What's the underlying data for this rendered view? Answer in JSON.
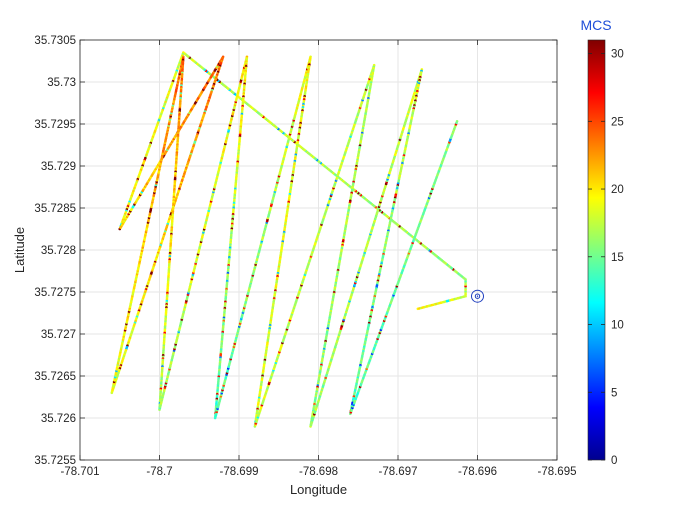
{
  "chart_data": {
    "type": "scatter",
    "title": "",
    "xlabel": "Longitude",
    "ylabel": "Latitude",
    "xlim": [
      -78.701,
      -78.695
    ],
    "ylim": [
      35.7255,
      35.7305
    ],
    "grid": true,
    "x_ticks": [
      -78.701,
      -78.7,
      -78.699,
      -78.698,
      -78.697,
      -78.696,
      -78.695
    ],
    "x_tick_labels": [
      "-78.701",
      "-78.7",
      "-78.699",
      "-78.698",
      "-78.697",
      "-78.696",
      "-78.695"
    ],
    "y_ticks": [
      35.7255,
      35.726,
      35.7265,
      35.727,
      35.7275,
      35.728,
      35.7285,
      35.729,
      35.7295,
      35.73,
      35.7305
    ],
    "y_tick_labels": [
      "35.7255",
      "35.726",
      "35.7265",
      "35.727",
      "35.7275",
      "35.728",
      "35.7285",
      "35.729",
      "35.7295",
      "35.73",
      "35.7305"
    ],
    "colorbar": {
      "title": "MCS",
      "title_color": "#1f4fd8",
      "colormap": "jet",
      "limits": [
        0,
        31
      ],
      "ticks": [
        0,
        5,
        10,
        15,
        20,
        25,
        30
      ],
      "tick_labels": [
        "0",
        "5",
        "10",
        "15",
        "20",
        "25",
        "30"
      ]
    },
    "marker": {
      "type": "circle-target",
      "x": -78.696,
      "y": 35.72745,
      "color": "#1f3fbf"
    },
    "path_vertices": [
      {
        "lon": -78.69675,
        "lat": 35.7273,
        "mcs": 19
      },
      {
        "lon": -78.69615,
        "lat": 35.72745,
        "mcs": 18
      },
      {
        "lon": -78.69615,
        "lat": 35.72765,
        "mcs": 16
      },
      {
        "lon": -78.6997,
        "lat": 35.73035,
        "mcs": 18
      },
      {
        "lon": -78.7005,
        "lat": 35.72825,
        "mcs": 20
      },
      {
        "lon": -78.6992,
        "lat": 35.7303,
        "mcs": 24
      },
      {
        "lon": -78.7006,
        "lat": 35.7263,
        "mcs": 18
      },
      {
        "lon": -78.6997,
        "lat": 35.7303,
        "mcs": 24
      },
      {
        "lon": -78.7,
        "lat": 35.7261,
        "mcs": 16
      },
      {
        "lon": -78.6989,
        "lat": 35.7303,
        "mcs": 20
      },
      {
        "lon": -78.6993,
        "lat": 35.726,
        "mcs": 14
      },
      {
        "lon": -78.6981,
        "lat": 35.7303,
        "mcs": 19
      },
      {
        "lon": -78.6988,
        "lat": 35.7259,
        "mcs": 18
      },
      {
        "lon": -78.6973,
        "lat": 35.7302,
        "mcs": 17
      },
      {
        "lon": -78.6981,
        "lat": 35.7259,
        "mcs": 16
      },
      {
        "lon": -78.6967,
        "lat": 35.73015,
        "mcs": 18
      },
      {
        "lon": -78.6976,
        "lat": 35.72605,
        "mcs": 14
      },
      {
        "lon": -78.69625,
        "lat": 35.72955,
        "mcs": 16
      }
    ],
    "series": [
      {
        "name": "",
        "description_values": "MCS per sample along flight path",
        "mcs_range": [
          0,
          31
        ]
      }
    ]
  }
}
